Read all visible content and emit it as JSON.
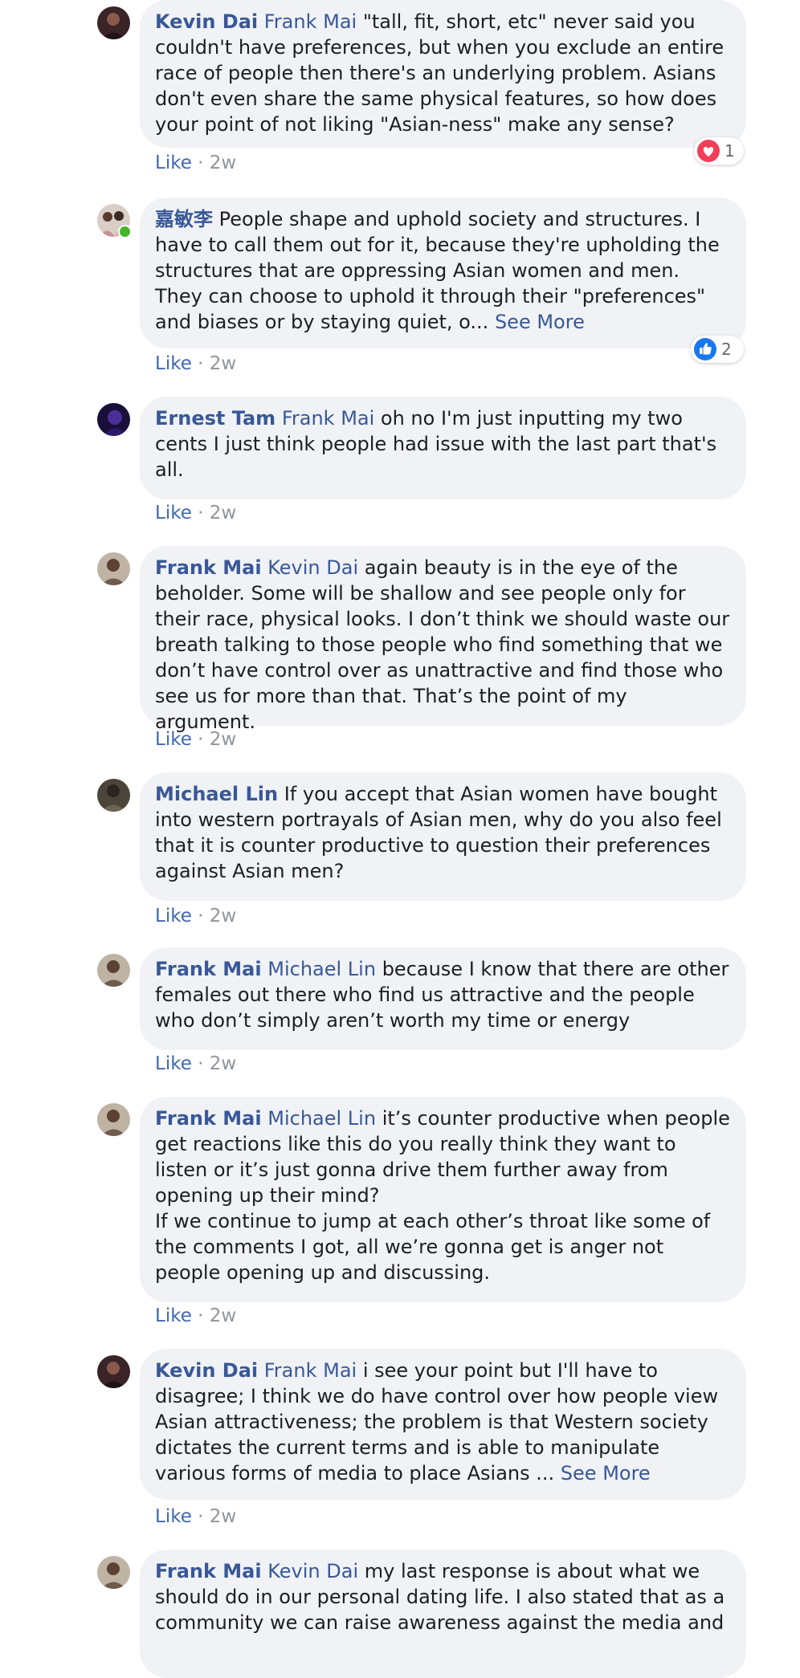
{
  "comments": [
    {
      "author": "Kevin Dai",
      "mention": "Frank Mai",
      "text": " \"tall, fit, short, etc\" never said you couldn't have preferences, but when you exclude an entire race of people then there's an underlying problem. Asians don't even share the same physical features, so how does your point of not liking \"Asian-ness\" make any sense?",
      "like": "Like",
      "time": "2w",
      "reaction": {
        "icon": "heart-icon",
        "count": "1"
      }
    },
    {
      "author": "嘉敏李",
      "text": " People shape and uphold society and structures. I have to call them out for it, because they're upholding the structures that are oppressing Asian women and men. They can choose to uphold it through their \"preferences\" and biases or by staying quiet, o... ",
      "see_more": "See More",
      "like": "Like",
      "time": "2w",
      "reaction": {
        "icon": "thumbs-up-icon",
        "count": "2"
      }
    },
    {
      "author": "Ernest Tam",
      "mention": "Frank Mai",
      "text": " oh no I'm just inputting my two cents I just think people had issue with the last part that's all.",
      "like": "Like",
      "time": "2w"
    },
    {
      "author": "Frank Mai",
      "mention": "Kevin Dai",
      "text": " again beauty is in the eye of the beholder. Some will be shallow and see people only for their race, physical looks. I don’t think we should waste our breath talking to those people who find something that we don’t have control over as unattractive and find those who see us for more than that. That’s the point of my argument.",
      "like": "Like",
      "time": "2w"
    },
    {
      "author": "Michael Lin",
      "text": " If you accept that Asian women have bought into western portrayals of Asian men, why do you also feel that it is counter productive to question their preferences against Asian men?",
      "like": "Like",
      "time": "2w"
    },
    {
      "author": "Frank Mai",
      "mention": "Michael Lin",
      "text": " because I know that there are other females out there who find us attractive and the people who don’t simply aren’t worth my time or energy",
      "like": "Like",
      "time": "2w"
    },
    {
      "author": "Frank Mai",
      "mention": "Michael Lin",
      "text": " it’s counter productive when people get reactions like this do you really think they want to listen or it’s just gonna drive them further away from opening up their mind?",
      "text2": "If we continue to jump at each other’s throat like some of the comments I got, all we’re gonna get is anger not people opening up and discussing.",
      "like": "Like",
      "time": "2w"
    },
    {
      "author": "Kevin Dai",
      "mention": "Frank Mai",
      "text": " i see your point but I'll have to disagree; I think we do have control over how people view Asian attractiveness; the problem is that Western society dictates the current terms and is able to manipulate various forms of media to place Asians ... ",
      "see_more": "See More",
      "like": "Like",
      "time": "2w"
    },
    {
      "author": "Frank Mai",
      "mention": "Kevin Dai",
      "text": " my last response is about what we should do in our personal dating life. I also stated that as a community we can raise awareness against the media and"
    }
  ],
  "sep": " · ",
  "colors": {
    "link": "#385898",
    "like": "#4267b2",
    "bubble": "#f0f2f5",
    "meta": "#90949c",
    "heart": "#f33e58",
    "thumb": "#1877f2"
  }
}
